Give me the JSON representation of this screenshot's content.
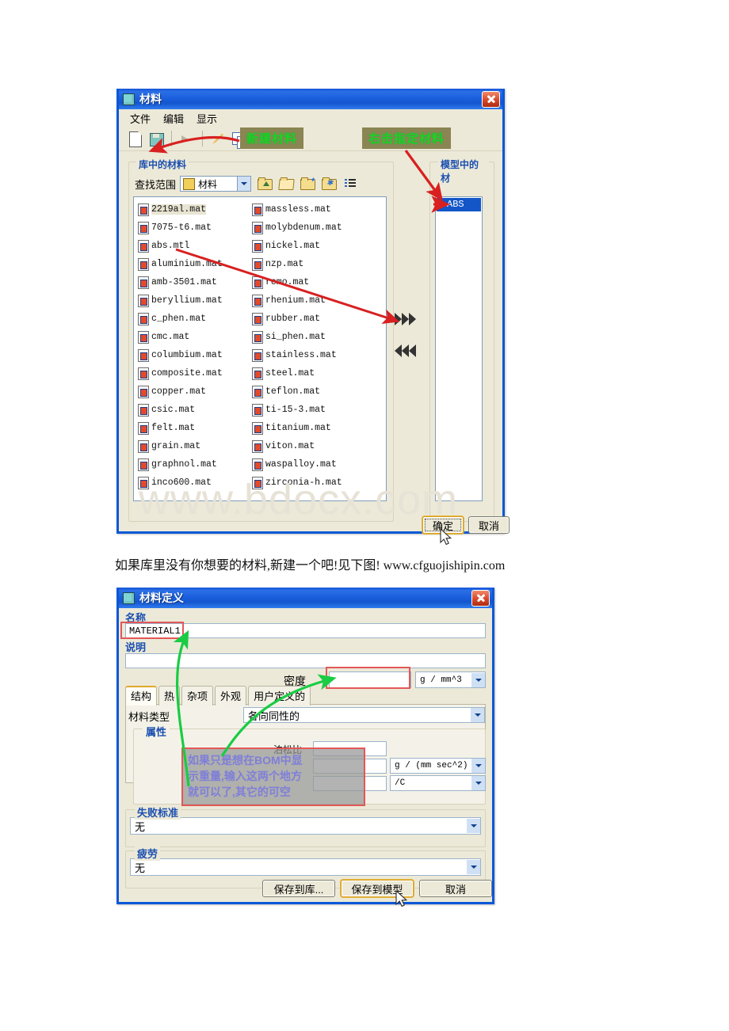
{
  "watermark": "www.bdocx.com",
  "caption": "如果库里没有你想要的材料,新建一个吧!见下图! www.cfguojishipin.com",
  "dialog_material": {
    "title": "材料",
    "close_label": "关闭",
    "menu": [
      "文件",
      "编辑",
      "显示"
    ],
    "toolbar_icons": [
      "new-document-icon",
      "save-icon",
      "apply-arrow-icon",
      "edit-pencil-icon",
      "copy-icon"
    ],
    "group_library_label": "库中的材料",
    "group_model_label": "模型中的材",
    "find_label": "查找范围",
    "find_value": "材料",
    "nav_icons": [
      "folder-up-icon",
      "folder-open-icon",
      "folder-new-icon",
      "folder-favorites-icon",
      "view-list-icon"
    ],
    "library_files_col1": [
      "2219al.mat",
      "7075-t6.mat",
      "abs.mtl",
      "aluminium.mat",
      "amb-3501.mat",
      "beryllium.mat",
      "c_phen.mat",
      "cmc.mat",
      "columbium.mat",
      "composite.mat",
      "copper.mat",
      "csic.mat",
      "felt.mat",
      "grain.mat",
      "graphnol.mat",
      "inco600.mat"
    ],
    "library_files_col2": [
      "massless.mat",
      "molybdenum.mat",
      "nickel.mat",
      "nzp.mat",
      "remo.mat",
      "rhenium.mat",
      "rubber.mat",
      "si_phen.mat",
      "stainless.mat",
      "steel.mat",
      "teflon.mat",
      "ti-15-3.mat",
      "titanium.mat",
      "viton.mat",
      "waspalloy.mat",
      "zirconia-h.mat"
    ],
    "model_materials": [
      "ABS"
    ],
    "move_right_label": "添加到模型",
    "move_left_label": "从模型移除",
    "ok_label": "确定",
    "cancel_label": "取消",
    "annotations": [
      {
        "text": "新建材料",
        "kind": "green-label"
      },
      {
        "text": "右击指定材料",
        "kind": "green-label"
      }
    ]
  },
  "dialog_matdef": {
    "title": "材料定义",
    "name_label": "名称",
    "name_value": "MATERIAL1",
    "desc_label": "说明",
    "desc_value": "",
    "density_label": "密度",
    "density_value": "",
    "density_unit": "g / mm^3",
    "tabs": [
      "结构",
      "热",
      "杂项",
      "外观",
      "用户定义的"
    ],
    "active_tab": "结构",
    "material_type_label": "材料类型",
    "material_type_value": "各向同性的",
    "properties_label": "属性",
    "poisson_label": "泊松比",
    "poisson_value": "",
    "unit_accel": "g / (mm sec^2)",
    "unit_temp": "/C",
    "failure_label": "失败标准",
    "failure_value": "无",
    "fatigue_label": "疲劳",
    "fatigue_value": "无",
    "save_lib_label": "保存到库...",
    "save_model_label": "保存到模型",
    "cancel_label": "取消",
    "note": "如果只是想在BOM中显示重量,输入这两个地方就可以了,其它的可空",
    "note_lines": [
      "如果只是想在BOM中显",
      "示重量,输入这两个地方",
      "就可以了,其它的可空"
    ]
  },
  "colors": {
    "title_blue": "#1453d6",
    "dialog_face": "#ece9d8",
    "selection_blue": "#1256c8",
    "annotation_green": "#21d021",
    "annotation_olive": "#8a8552",
    "annotation_red": "#e35757",
    "arrow_red": "#d82020",
    "arrow_green": "#19cc44"
  }
}
